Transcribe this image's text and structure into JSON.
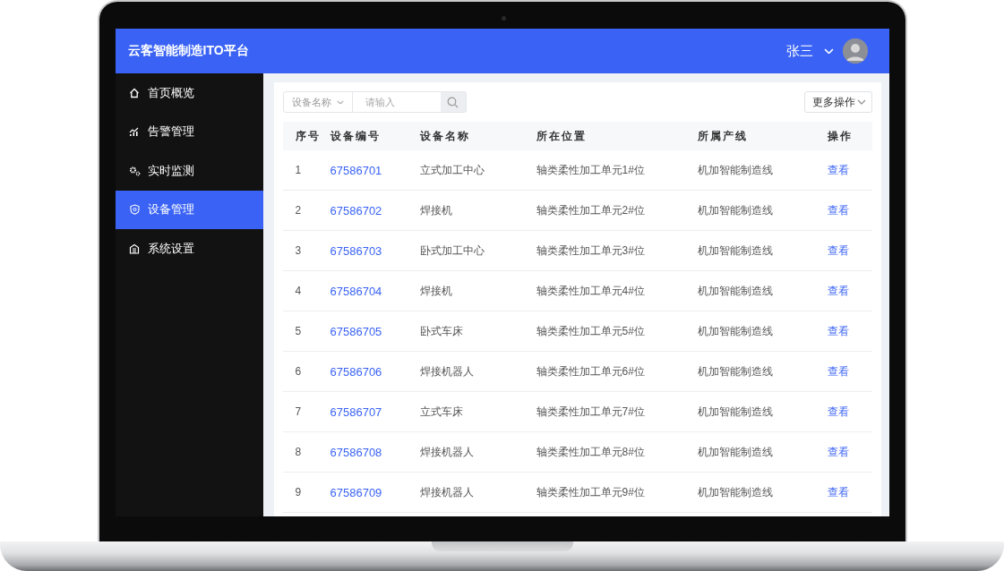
{
  "app": {
    "title": "云客智能制造ITO平台"
  },
  "user": {
    "name": "张三"
  },
  "sidebar": {
    "items": [
      {
        "label": "首页概览",
        "selected": false
      },
      {
        "label": "告警管理",
        "selected": false
      },
      {
        "label": "实时监测",
        "selected": false
      },
      {
        "label": "设备管理",
        "selected": true
      },
      {
        "label": "系统设置",
        "selected": false
      }
    ]
  },
  "search": {
    "field": "设备名称",
    "placeholder": "请输入"
  },
  "more_button": "更多操作",
  "table": {
    "columns": [
      "序号",
      "设备编号",
      "设备名称",
      "所在位置",
      "所属产线",
      "操作"
    ],
    "rows": [
      [
        "1",
        "67586701",
        "立式加工中心",
        "轴类柔性加工单元1#位",
        "机加智能制造线",
        "查看"
      ],
      [
        "2",
        "67586702",
        "焊接机",
        "轴类柔性加工单元2#位",
        "机加智能制造线",
        "查看"
      ],
      [
        "3",
        "67586703",
        "卧式加工中心",
        "轴类柔性加工单元3#位",
        "机加智能制造线",
        "查看"
      ],
      [
        "4",
        "67586704",
        "焊接机",
        "轴类柔性加工单元4#位",
        "机加智能制造线",
        "查看"
      ],
      [
        "5",
        "67586705",
        "卧式车床",
        "轴类柔性加工单元5#位",
        "机加智能制造线",
        "查看"
      ],
      [
        "6",
        "67586706",
        "焊接机器人",
        "轴类柔性加工单元6#位",
        "机加智能制造线",
        "查看"
      ],
      [
        "7",
        "67586707",
        "立式车床",
        "轴类柔性加工单元7#位",
        "机加智能制造线",
        "查看"
      ],
      [
        "8",
        "67586708",
        "焊接机器人",
        "轴类柔性加工单元8#位",
        "机加智能制造线",
        "查看"
      ],
      [
        "9",
        "67586709",
        "焊接机器人",
        "轴类柔性加工单元9#位",
        "机加智能制造线",
        "查看"
      ]
    ]
  }
}
